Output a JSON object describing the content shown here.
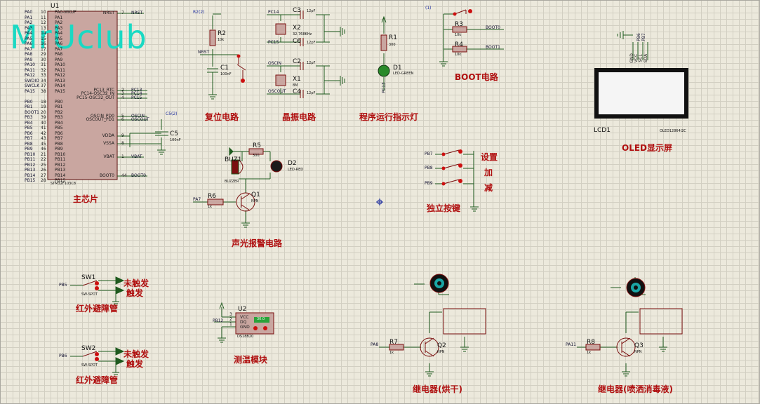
{
  "watermark": "MrUclub",
  "sections": {
    "mcu": "主芯片",
    "reset": "复位电路",
    "crystal": "晶振电路",
    "run_led": "程序运行指示灯",
    "boot": "BOOT电路",
    "oled": "OLED显示屏",
    "alarm": "声光报警电路",
    "keys": "独立按键",
    "ir1": "红外避障管",
    "ir2": "红外避障管",
    "temp": "测温模块",
    "relay1": "继电器(烘干)",
    "relay2": "继电器(喷洒消毒液)"
  },
  "mcu": {
    "ref": "U1",
    "part": "STM32F103C8",
    "left_pins": [
      {
        "net": "PA0",
        "num": "10",
        "name": "PA0-WKUP"
      },
      {
        "net": "PA1",
        "num": "11",
        "name": "PA1"
      },
      {
        "net": "PA2",
        "num": "12",
        "name": "PA2"
      },
      {
        "net": "PA3",
        "num": "13",
        "name": "PA3"
      },
      {
        "net": "PA4",
        "num": "14",
        "name": "PA4"
      },
      {
        "net": "PA5",
        "num": "15",
        "name": "PA5"
      },
      {
        "net": "PA6",
        "num": "16",
        "name": "PA6"
      },
      {
        "net": "PA7",
        "num": "17",
        "name": "PA7"
      },
      {
        "net": "PA8",
        "num": "29",
        "name": "PA8"
      },
      {
        "net": "PA9",
        "num": "30",
        "name": "PA9"
      },
      {
        "net": "PA10",
        "num": "31",
        "name": "PA10"
      },
      {
        "net": "PA11",
        "num": "32",
        "name": "PA11"
      },
      {
        "net": "PA12",
        "num": "33",
        "name": "PA12"
      },
      {
        "net": "SWDIO",
        "num": "34",
        "name": "PA13"
      },
      {
        "net": "SWCLK",
        "num": "37",
        "name": "PA14"
      },
      {
        "net": "PA15",
        "num": "38",
        "name": "PA15"
      },
      {
        "net": "",
        "num": "",
        "name": ""
      },
      {
        "net": "PB0",
        "num": "18",
        "name": "PB0"
      },
      {
        "net": "PB1",
        "num": "19",
        "name": "PB1"
      },
      {
        "net": "BOOT1",
        "num": "20",
        "name": "PB2"
      },
      {
        "net": "PB3",
        "num": "39",
        "name": "PB3"
      },
      {
        "net": "PB4",
        "num": "40",
        "name": "PB4"
      },
      {
        "net": "PB5",
        "num": "41",
        "name": "PB5"
      },
      {
        "net": "PB6",
        "num": "42",
        "name": "PB6"
      },
      {
        "net": "PB7",
        "num": "43",
        "name": "PB7"
      },
      {
        "net": "PB8",
        "num": "45",
        "name": "PB8"
      },
      {
        "net": "PB9",
        "num": "46",
        "name": "PB9"
      },
      {
        "net": "PB10",
        "num": "21",
        "name": "PB10"
      },
      {
        "net": "PB11",
        "num": "22",
        "name": "PB11"
      },
      {
        "net": "PB12",
        "num": "25",
        "name": "PB12"
      },
      {
        "net": "PB13",
        "num": "26",
        "name": "PB13"
      },
      {
        "net": "PB14",
        "num": "27",
        "name": "PB14"
      },
      {
        "net": "PB15",
        "num": "28",
        "name": "PB15"
      }
    ],
    "right_pins": [
      {
        "name": "NRST",
        "num": "7",
        "net": "NRST"
      },
      {
        "name": "PC13_RTC",
        "num": "2",
        "net": "PC13"
      },
      {
        "name": "PC14-OSC32_IN",
        "num": "3",
        "net": "PC14"
      },
      {
        "name": "PC15-OSC32_OUT",
        "num": "4",
        "net": "PC15"
      },
      {
        "name": "OSCIN_PD0",
        "num": "5",
        "net": "OSCIN"
      },
      {
        "name": "OSCOUT_PD1",
        "num": "6",
        "net": "OSCOUT"
      },
      {
        "name": "VDDA",
        "num": "9",
        "net": ""
      },
      {
        "name": "VSSA",
        "num": "8",
        "net": ""
      },
      {
        "name": "VBAT",
        "num": "1",
        "net": "VBAT"
      },
      {
        "name": "BOOT0",
        "num": "44",
        "net": "BOOT0"
      }
    ]
  },
  "reset": {
    "r_ref": "R2",
    "r_val": "10k",
    "c_ref": "C1",
    "c_val": "100nF",
    "net": "NRST",
    "power": "R2(2)"
  },
  "crystal": {
    "nets": [
      "PC14",
      "PC15",
      "OSCIN",
      "OSCOUT"
    ],
    "x2_ref": "X2",
    "x2_val": "32.768KHz",
    "x1_ref": "X1",
    "x1_val": "8M",
    "caps": [
      {
        "ref": "C3",
        "val": "12pF"
      },
      {
        "ref": "C6",
        "val": "12pF"
      },
      {
        "ref": "C2",
        "val": "12pF"
      },
      {
        "ref": "C4",
        "val": "12pF"
      }
    ]
  },
  "runled": {
    "r_ref": "R1",
    "r_val": "300",
    "d_ref": "D1",
    "d_val": "LED-GREEN",
    "net": "PC13"
  },
  "boot": {
    "power": "(1)",
    "r3_ref": "R3",
    "r3_val": "10k",
    "r4_ref": "R4",
    "r4_val": "10k",
    "net0": "BOOT0",
    "net1": "BOOT1"
  },
  "vdda": {
    "c_ref": "C5",
    "c_val": "100nF",
    "power": "C5(2)"
  },
  "oled": {
    "ref": "LCD1",
    "part": "OLED12864I2C",
    "pins": [
      "GND",
      "VCC",
      "SCL",
      "SDA"
    ],
    "nets": [
      "PB6",
      "PB7"
    ]
  },
  "alarm": {
    "r5_ref": "R5",
    "r5_val": "300",
    "buz_ref": "BUZ1",
    "buz_val": "BUZZER",
    "d_ref": "D2",
    "d_val": "LED-RED",
    "r6_ref": "R6",
    "r6_val": "1k",
    "q_ref": "Q1",
    "q_val": "NPN",
    "net": "PA7"
  },
  "keys": {
    "nets": [
      "PB7",
      "PB8",
      "PB9"
    ],
    "labels": [
      "设置",
      "加",
      "减"
    ]
  },
  "ir1": {
    "ref": "SW1",
    "val": "SW-SPDT",
    "net": "PB5",
    "state_a": "未触发",
    "state_b": "触发"
  },
  "ir2": {
    "ref": "SW2",
    "val": "SW-SPDT",
    "net": "PB6",
    "state_a": "未触发",
    "state_b": "触发"
  },
  "temp": {
    "ref": "U2",
    "part": "DS18B20",
    "net": "PB12",
    "pins": [
      "VCC",
      "DQ",
      "GND"
    ],
    "pin_nums": [
      "3",
      "2",
      "1"
    ],
    "reading": "30.0"
  },
  "relay1": {
    "r_ref": "R7",
    "r_val": "1k",
    "q_ref": "Q2",
    "q_val": "NPN",
    "net": "PA8"
  },
  "relay2": {
    "r_ref": "R8",
    "r_val": "1k",
    "q_ref": "Q3",
    "q_val": "NPN",
    "net": "PA11"
  },
  "colors": {
    "wire": "#1e5a1e",
    "part": "#7a0e0e",
    "text": "#101010",
    "accent": "#b01010",
    "background": "#ece9dc"
  }
}
